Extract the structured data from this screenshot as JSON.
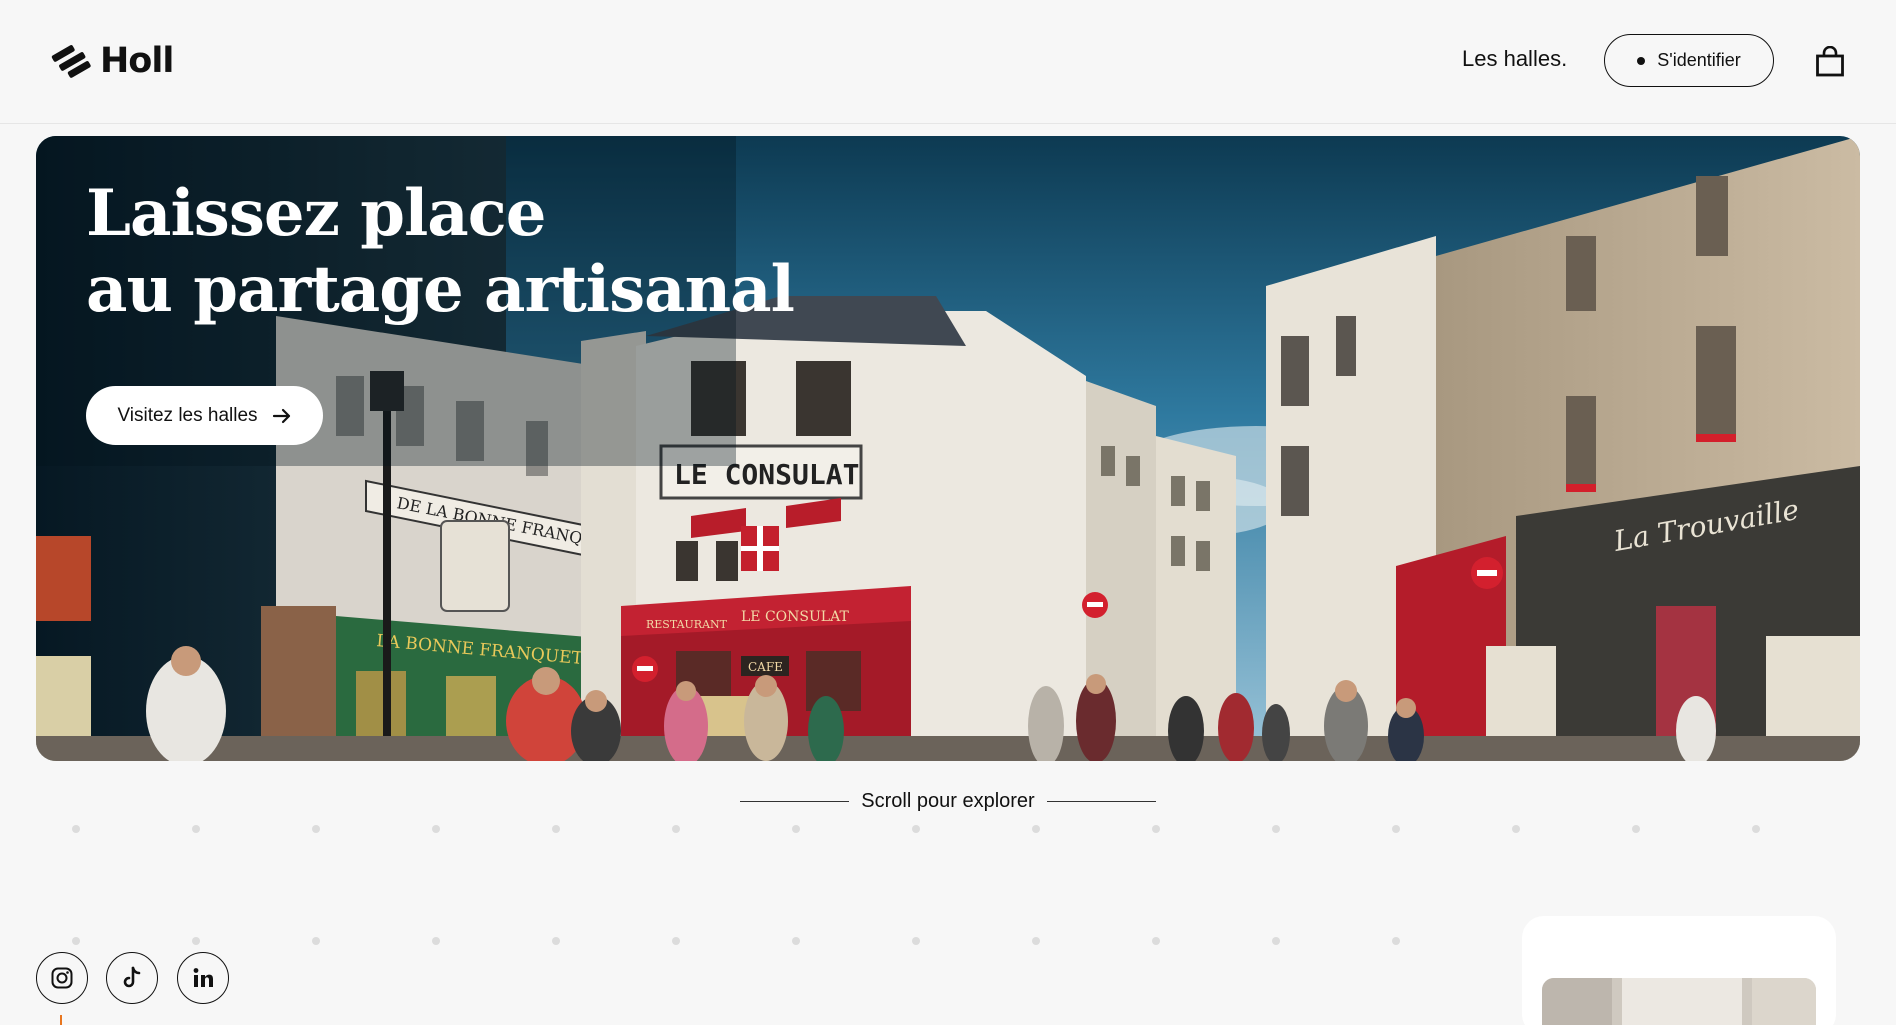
{
  "header": {
    "brand": "Holl",
    "nav_link": "Les halles.",
    "login_label": "S'identifier"
  },
  "hero": {
    "title_line1": "Laissez place",
    "title_line2": "au partage artisanal",
    "cta_label": "Visitez les halles",
    "signs": {
      "consulat": "LE CONSULAT",
      "restaurant": "RESTAURANT",
      "consulat_awning": "LE CONSULAT",
      "cafe": "CAFE",
      "bonne_franquette": "DE LA BONNE FRANQUETTE",
      "bonne_franquette_green": "LA BONNE FRANQUETTE",
      "trouvaille": "La Trouvaille"
    }
  },
  "scroll_hint": "Scroll pour explorer",
  "colors": {
    "background": "#f7f7f7",
    "accent": "#e8761f",
    "text": "#111111"
  },
  "social": {
    "icons": [
      "instagram-icon",
      "tiktok-icon",
      "linkedin-icon"
    ]
  }
}
